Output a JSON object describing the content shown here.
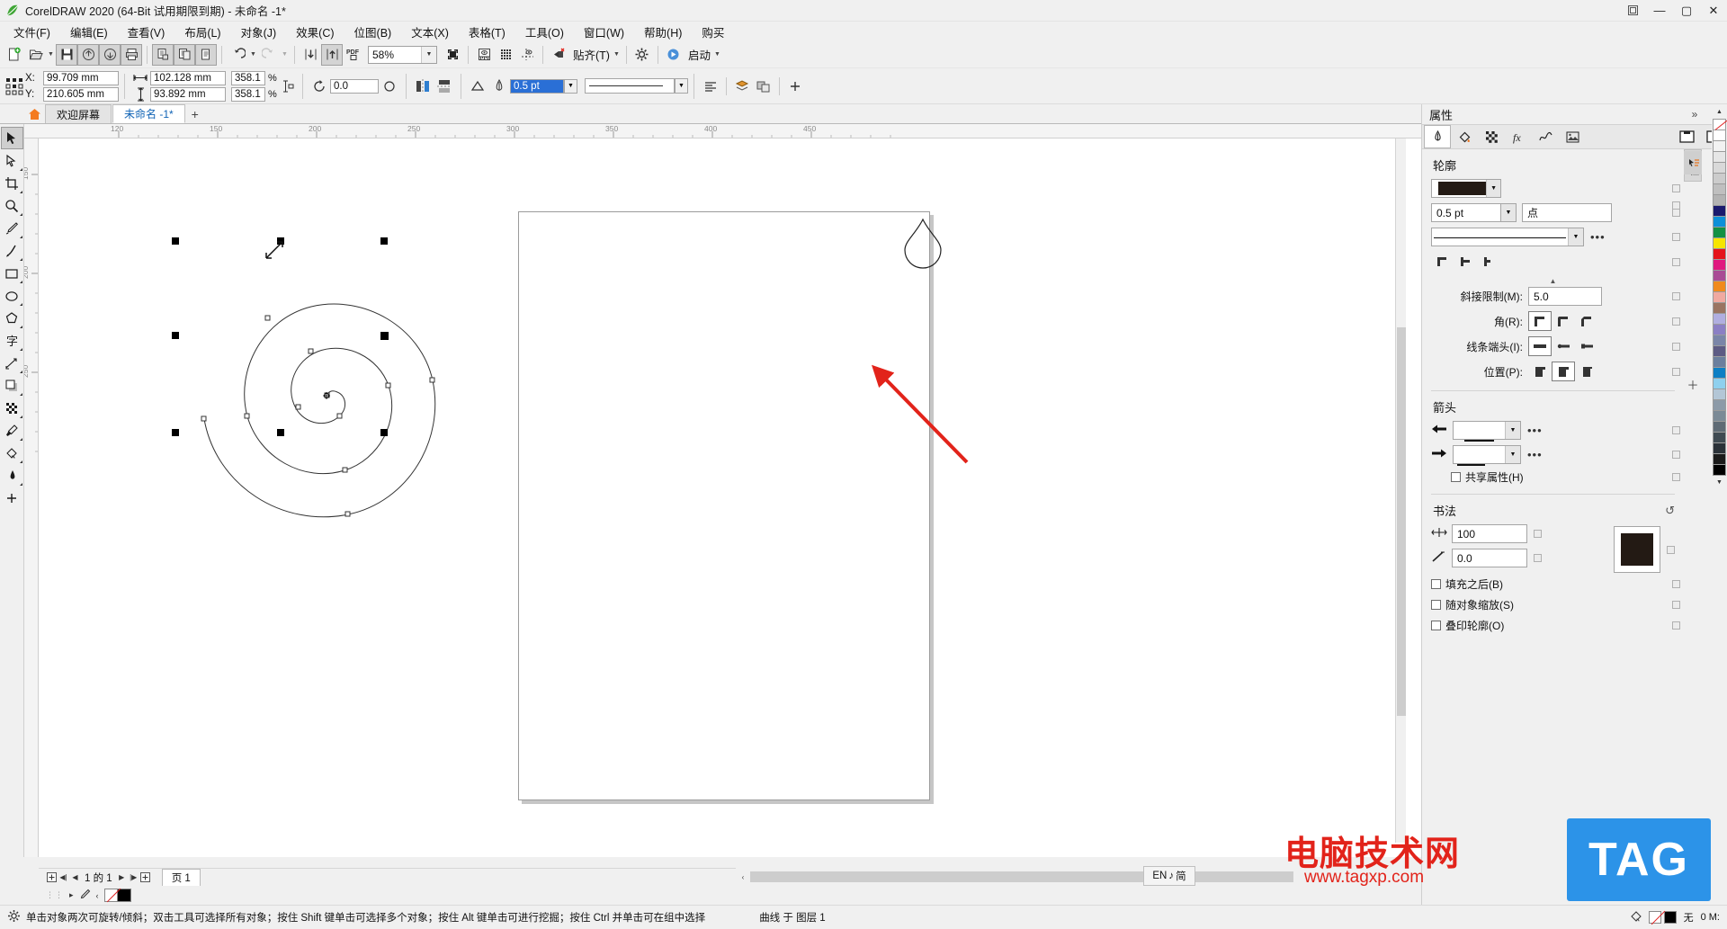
{
  "window": {
    "title": "CorelDRAW 2020 (64-Bit 试用期限到期) - 未命名 -1*",
    "minimize": "—",
    "maximize": "▢",
    "close": "✕",
    "restore_icon": "⧉"
  },
  "menu": {
    "items": [
      {
        "label": "文件(F)",
        "name": "menu-file"
      },
      {
        "label": "编辑(E)",
        "name": "menu-edit"
      },
      {
        "label": "查看(V)",
        "name": "menu-view"
      },
      {
        "label": "布局(L)",
        "name": "menu-layout"
      },
      {
        "label": "对象(J)",
        "name": "menu-object"
      },
      {
        "label": "效果(C)",
        "name": "menu-effects"
      },
      {
        "label": "位图(B)",
        "name": "menu-bitmap"
      },
      {
        "label": "文本(X)",
        "name": "menu-text"
      },
      {
        "label": "表格(T)",
        "name": "menu-table"
      },
      {
        "label": "工具(O)",
        "name": "menu-tools"
      },
      {
        "label": "窗口(W)",
        "name": "menu-window"
      },
      {
        "label": "帮助(H)",
        "name": "menu-help"
      },
      {
        "label": "购买",
        "name": "menu-buy"
      }
    ]
  },
  "standard_toolbar": {
    "zoom_value": "58%",
    "snap_label": "贴齐(T)",
    "launch_label": "启动",
    "pdf_label": "PDF",
    "buttons": [
      "new-document",
      "open-document",
      "save-document",
      "import",
      "export",
      "print",
      "publish-pdf",
      "copy",
      "paste",
      "undo",
      "redo",
      "import-arrow",
      "export-arrow",
      "zoom-level",
      "full-screen",
      "show-rulers",
      "show-grid",
      "show-guides",
      "snap-to"
    ]
  },
  "property_bar": {
    "x_label": "X:",
    "y_label": "Y:",
    "x_value": "99.709 mm",
    "y_value": "210.605 mm",
    "width_value": "102.128 mm",
    "height_value": "93.892 mm",
    "scale_w": "358.1",
    "scale_h": "358.1",
    "percent": "%",
    "rotation": "0.0",
    "outline_width": "0.5 pt"
  },
  "tabs": {
    "home_icon": "home-icon",
    "items": [
      {
        "label": "欢迎屏幕",
        "active": false
      },
      {
        "label": "未命名 -1*",
        "active": true
      }
    ],
    "add_label": "+"
  },
  "toolbox": {
    "tools": [
      {
        "name": "pick-tool",
        "glyph": "pick",
        "active": true
      },
      {
        "name": "shape-tool",
        "glyph": "shape",
        "active": false
      },
      {
        "name": "crop-tool",
        "glyph": "crop",
        "active": false
      },
      {
        "name": "zoom-tool",
        "glyph": "zoom",
        "active": false
      },
      {
        "name": "freehand-tool",
        "glyph": "pen",
        "active": false
      },
      {
        "name": "artistic-media-tool",
        "glyph": "brush",
        "active": false
      },
      {
        "name": "rectangle-tool",
        "glyph": "rect",
        "active": false
      },
      {
        "name": "ellipse-tool",
        "glyph": "ellipse",
        "active": false
      },
      {
        "name": "polygon-tool",
        "glyph": "polygon",
        "active": false
      },
      {
        "name": "text-tool",
        "glyph": "text",
        "active": false
      },
      {
        "name": "parallel-dimension-tool",
        "glyph": "dimension",
        "active": false
      },
      {
        "name": "drop-shadow-tool",
        "glyph": "shadow",
        "active": false
      },
      {
        "name": "transparency-tool",
        "glyph": "transparency",
        "active": false
      },
      {
        "name": "color-eyedropper-tool",
        "glyph": "eyedropper",
        "active": false
      },
      {
        "name": "interactive-fill-tool",
        "glyph": "fill",
        "active": false
      },
      {
        "name": "smart-fill-tool",
        "glyph": "smartfill",
        "active": false
      },
      {
        "name": "add-tool",
        "glyph": "plus",
        "active": false
      }
    ]
  },
  "rulers": {
    "horizontal_labels": [
      "120",
      "150",
      "200",
      "250",
      "300",
      "350",
      "400",
      "450"
    ],
    "vertical_labels": [
      "150",
      "200",
      "250"
    ],
    "unit": "mm"
  },
  "dock": {
    "title": "属性",
    "collapse_icon": "chevron-double-right-icon",
    "close_icon": "close-icon",
    "tabs": [
      {
        "name": "outline-tab",
        "glyph": "pen-nib",
        "active": true
      },
      {
        "name": "fill-tab",
        "glyph": "fill-bucket",
        "active": false
      },
      {
        "name": "transparency-tab",
        "glyph": "checkerboard",
        "active": false
      },
      {
        "name": "effects-tab",
        "glyph": "fx",
        "active": false
      },
      {
        "name": "curve-tab",
        "glyph": "curve",
        "active": false
      },
      {
        "name": "bitmap-tab",
        "glyph": "bitmap",
        "active": false
      },
      {
        "name": "page-tab",
        "glyph": "page",
        "active": false
      },
      {
        "name": "layers-tab",
        "glyph": "layer-eye",
        "active": false
      }
    ],
    "vertical_tabs": [
      "属性"
    ],
    "outline": {
      "section_title": "轮廓",
      "color": "#231a14",
      "width_value": "0.5 pt",
      "unit_value": "点",
      "style_preview": "solid-line",
      "more_label": "•••",
      "miter_label": "斜接限制(M):",
      "miter_value": "5.0",
      "corner_label": "角(R):",
      "cap_label": "线条端头(I):",
      "position_label": "位置(P):"
    },
    "arrows": {
      "section_title": "箭头",
      "start_more": "•••",
      "end_more": "•••",
      "share_attributes_label": "共享属性(H)",
      "share_attributes_checked": false
    },
    "calligraphy": {
      "section_title": "书法",
      "reset_icon": "reset-icon",
      "stretch_value": "100",
      "angle_value": "0.0",
      "color": "#231a14",
      "behind_fill_label": "填充之后(B)",
      "scale_with_object_label": "随对象缩放(S)",
      "overprint_outline_label": "叠印轮廓(O)",
      "behind_fill_checked": false,
      "scale_with_object_checked": false,
      "overprint_checked": false
    }
  },
  "page_navigator": {
    "page_info": "1 的 1",
    "page_tab": "页 1",
    "first": "◀|",
    "prev": "◀",
    "next": "▶",
    "last": "|▶"
  },
  "status_bar": {
    "hint": "单击对象两次可旋转/倾斜；双击工具可选择所有对象；按住 Shift 键单击可选择多个对象；按住 Alt 键单击可进行挖掘；按住 Ctrl 并单击可在组中选择",
    "object_info": "曲线 于 图层 1",
    "fill_label": "无",
    "outline_info": "0 M:",
    "gear_icon": "gear-icon"
  },
  "ime": {
    "lang": "EN",
    "mode_icon": "♪",
    "input_mode": "简"
  },
  "watermark": {
    "text": "电脑技术网",
    "url": "www.tagxp.com",
    "badge": "TAG"
  },
  "palette": {
    "colors": [
      "#ffffff",
      "#f2f2f2",
      "#e6e6e6",
      "#d9d9d9",
      "#cccccc",
      "#bfbfbf",
      "#b3b3b3",
      "#1a1a6e",
      "#0d90d8",
      "#139144",
      "#f6e500",
      "#e5131b",
      "#e0197f",
      "#a94b95",
      "#f08a1d",
      "#f0a9a0",
      "#9a7461",
      "#b0aee0",
      "#8b7fc4",
      "#7a85a8",
      "#5d5b84",
      "#6b7f9e",
      "#0d7fc4",
      "#8fd0ee",
      "#b3c6d6",
      "#8c9aa8",
      "#7b8a96",
      "#5f6b75",
      "#3f4a52",
      "#2a3138",
      "#1a1a1a",
      "#000000"
    ]
  },
  "canvas": {
    "shape_name": "spiral",
    "selection_handles": 8,
    "annotation_arrow_color": "#e2231a"
  }
}
